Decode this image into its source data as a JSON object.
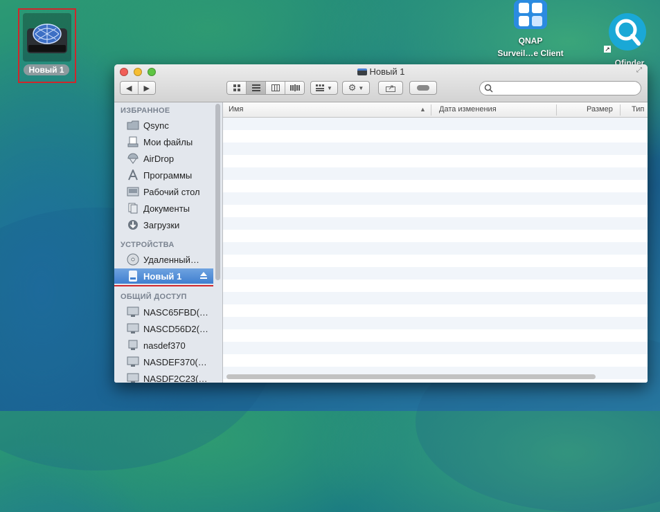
{
  "desktop": {
    "selected_volume_label": "Новый 1",
    "qnap_icon_label_1": "QNAP",
    "qnap_icon_label_2": "Surveil…e Client",
    "qfinder_label": "Qfinder"
  },
  "window": {
    "title": "Новый 1",
    "search_placeholder": ""
  },
  "sidebar": {
    "favorites_heading": "ИЗБРАННОЕ",
    "favorites": [
      {
        "label": "Qsync",
        "icon": "folder-icon"
      },
      {
        "label": "Мои файлы",
        "icon": "all-files-icon"
      },
      {
        "label": "AirDrop",
        "icon": "airdrop-icon"
      },
      {
        "label": "Программы",
        "icon": "applications-icon"
      },
      {
        "label": "Рабочий стол",
        "icon": "desktop-icon"
      },
      {
        "label": "Документы",
        "icon": "documents-icon"
      },
      {
        "label": "Загрузки",
        "icon": "downloads-icon"
      }
    ],
    "devices_heading": "УСТРОЙСТВА",
    "devices": [
      {
        "label": "Удаленный…",
        "icon": "remote-disc-icon"
      },
      {
        "label": "Новый 1",
        "icon": "drive-icon",
        "selected": true
      }
    ],
    "shared_heading": "ОБЩИЙ ДОСТУП",
    "shared": [
      {
        "label": "NASC65FBD(…",
        "icon": "network-computer-icon"
      },
      {
        "label": "NASCD56D2(…",
        "icon": "network-computer-icon"
      },
      {
        "label": "nasdef370",
        "icon": "network-computer-icon"
      },
      {
        "label": "NASDEF370(…",
        "icon": "network-computer-icon"
      },
      {
        "label": "NASDF2C23(…",
        "icon": "network-computer-icon"
      }
    ]
  },
  "columns": {
    "name": "Имя",
    "date_modified": "Дата изменения",
    "size": "Размер",
    "kind": "Тип"
  },
  "colors": {
    "selection": "#3f7fd0",
    "highlight_border": "#d0262b"
  }
}
